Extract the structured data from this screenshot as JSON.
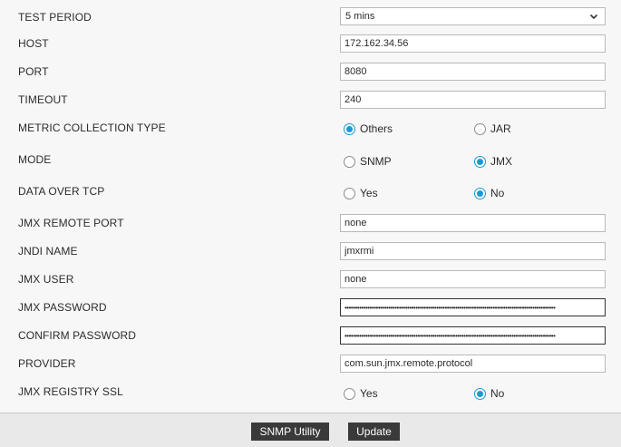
{
  "form": {
    "test_period": {
      "label": "TEST PERIOD",
      "value": "5 mins"
    },
    "host": {
      "label": "HOST",
      "value": "172.162.34.56"
    },
    "port": {
      "label": "PORT",
      "value": "8080"
    },
    "timeout": {
      "label": "TIMEOUT",
      "value": "240"
    },
    "metric_collection_type": {
      "label": "METRIC COLLECTION TYPE",
      "options": [
        "Others",
        "JAR"
      ],
      "selected": "Others"
    },
    "mode": {
      "label": "MODE",
      "options": [
        "SNMP",
        "JMX"
      ],
      "selected": "JMX"
    },
    "data_over_tcp": {
      "label": "DATA OVER TCP",
      "options": [
        "Yes",
        "No"
      ],
      "selected": "No"
    },
    "jmx_remote_port": {
      "label": "JMX REMOTE PORT",
      "value": "none"
    },
    "jndi_name": {
      "label": "JNDI NAME",
      "value": "jmxrmi"
    },
    "jmx_user": {
      "label": "JMX USER",
      "value": "none"
    },
    "jmx_password": {
      "label": "JMX PASSWORD",
      "value": "•••••••••••••••••••••••••••••••••••••••••••••••••••••••••••••••••••••••••••••••••••••••••••••••••••••"
    },
    "confirm_password": {
      "label": "CONFIRM PASSWORD",
      "value": "•••••••••••••••••••••••••••••••••••••••••••••••••••••••••••••••••••••••••••••••••••••••••••••••••••••"
    },
    "provider": {
      "label": "PROVIDER",
      "value": "com.sun.jmx.remote.protocol"
    },
    "jmx_registry_ssl": {
      "label": "JMX REGISTRY SSL",
      "options": [
        "Yes",
        "No"
      ],
      "selected": "No"
    }
  },
  "footer": {
    "snmp_utility_label": "SNMP Utility",
    "update_label": "Update"
  },
  "icons": {
    "dropdown": "chevron-down-icon"
  },
  "colors": {
    "accent": "#1b9ad1",
    "button_bg": "#3a3a3a",
    "page_bg": "#f7f7f7",
    "footer_bg": "#e9e9e9"
  }
}
